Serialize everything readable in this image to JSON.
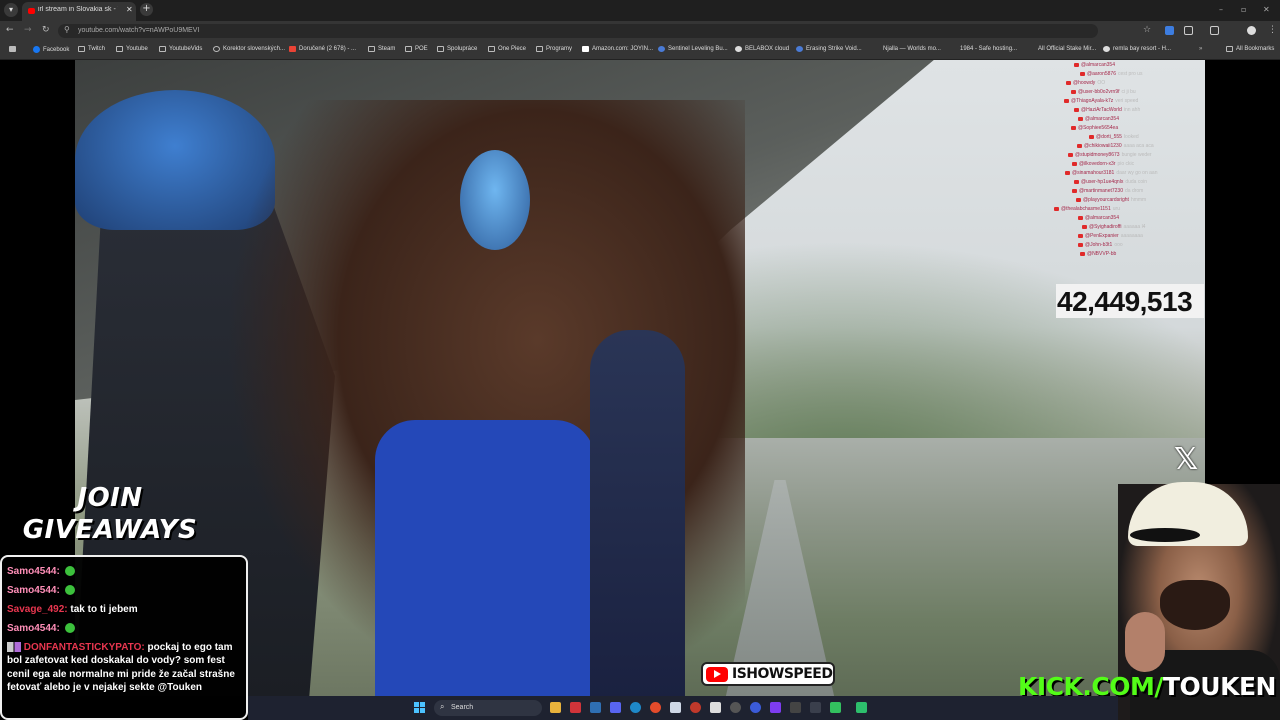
{
  "browser": {
    "tab_title": "irl stream in Slovakia sk - Y",
    "url": "youtube.com/watch?v=nAWPoU9MEVI",
    "bookmarks": [
      "Facebook",
      "Twitch",
      "Youtube",
      "YoutubeVids",
      "Korektor slovenských...",
      "Doručené (2 678) - ...",
      "Steam",
      "POE",
      "Spolupráce",
      "One Piece",
      "Programy",
      "Amazon.com: JOYIN...",
      "Sentinel Leveling Bu...",
      "BELABOX cloud",
      "Erasing Strike Void...",
      "Njalla — Worlds mo...",
      "1984 - Safe hosting...",
      "All Official Stake Mir...",
      "remla bay resort - H..."
    ],
    "all_bookmarks": "All Bookmarks"
  },
  "video": {
    "counter": "42,449,513",
    "channel_badge": "ISHOWSPEED",
    "overlay_chat": [
      {
        "name": "@almarcan354",
        "msg": ""
      },
      {
        "name": "@aaron5876",
        "msg": "cest pro us"
      },
      {
        "name": "@hoowdy",
        "msg": "OO"
      },
      {
        "name": "@user-bb0o2vrn9f",
        "msg": "ci ji bu"
      },
      {
        "name": "@ThiagoAyala-k7z",
        "msg": "veri speed"
      },
      {
        "name": "@HaziArTacWorld",
        "msg": "inn ahh"
      },
      {
        "name": "@almarcan354",
        "msg": ""
      },
      {
        "name": "@Sophiee5654ea",
        "msg": ""
      },
      {
        "name": "@dorti_555",
        "msg": "looked"
      },
      {
        "name": "@chikiowaii1230",
        "msg": "aaaa aca aca"
      },
      {
        "name": "@stupidmoney8673",
        "msg": "bungie weder"
      },
      {
        "name": "@ilkovedorn-x3r",
        "msg": "pio ckic"
      },
      {
        "name": "@sinamahour3181",
        "msg": "daar wy go on aan"
      },
      {
        "name": "@user-hp1ue4qnlx",
        "msg": "duda coin"
      },
      {
        "name": "@martinmanet7230",
        "msg": "da drom"
      },
      {
        "name": "@playyourcardsright",
        "msg": "hmmm"
      },
      {
        "name": "@thealabchasme1151",
        "msg": "uru"
      },
      {
        "name": "@almarcan354",
        "msg": ""
      },
      {
        "name": "@Syighadiroffi",
        "msg": "aaaaaa l4"
      },
      {
        "name": "@PenExpanier",
        "msg": "aaaaaaaa"
      },
      {
        "name": "@John-b3t1",
        "msg": "ooo"
      },
      {
        "name": "@NBVVP-bb",
        "msg": ""
      }
    ]
  },
  "overlays": {
    "giveaways_line1": "JOIN",
    "giveaways_line2": "GIVEAWAYS",
    "kick_prefix": "KICK.COM/",
    "kick_handle": "TOUKEN"
  },
  "chat": {
    "lines": [
      {
        "name": "Samo4544:",
        "msg": "",
        "color": "#ff8fb8"
      },
      {
        "name": "Samo4544:",
        "msg": "",
        "color": "#ff8fb8"
      },
      {
        "name": "Savage_492:",
        "msg": "tak to ti jebem",
        "color": "#e8364f"
      },
      {
        "name": "Samo4544:",
        "msg": "",
        "color": "#ff8fb8"
      }
    ],
    "long_name": "DONFANTASTICKYPATO:",
    "long_name_color": "#e8364f",
    "long_msg": "pockaj to ego tam bol zafetovat ked doskakal do vody? som fest cenil ega ale normalne mi pride že začal strašne fetovať alebo je v nejakej sekte @Touken"
  },
  "taskbar": {
    "search_label": "Search"
  },
  "colors": {
    "kick_green": "#53fc18",
    "chat_name": "#ff8fb8",
    "chat_name_alt": "#e8364f"
  }
}
